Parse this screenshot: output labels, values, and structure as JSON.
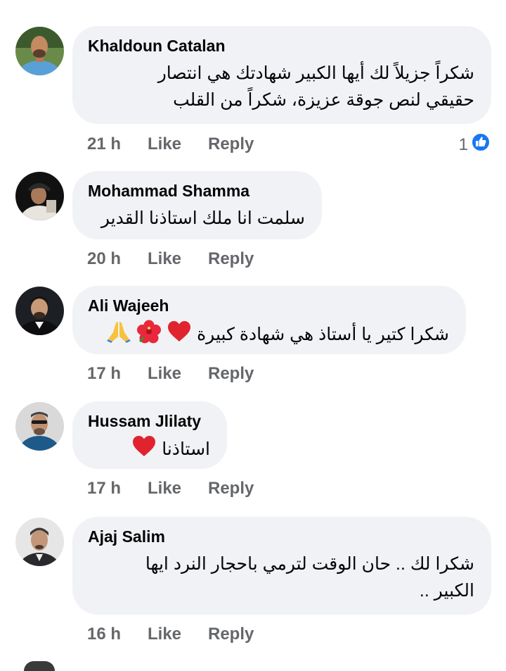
{
  "comments": [
    {
      "author": "Khaldoun Catalan",
      "lines": [
        "شكراً جزيلاً لك أيها الكبير شهادتك هي انتصار",
        "حقيقي لنص جوقة عزيزة، شكراً من القلب"
      ],
      "time": "21 h",
      "like_label": "Like",
      "reply_label": "Reply",
      "reactions": {
        "count": "1",
        "icon": "thumbs-up-icon",
        "color": "#1877f2"
      }
    },
    {
      "author": "Mohammad Shamma",
      "lines": [
        "سلمت انا ملك استاذنا القدير"
      ],
      "time": "20 h",
      "like_label": "Like",
      "reply_label": "Reply"
    },
    {
      "author": "Ali Wajeeh",
      "lines": [
        "شكرا كتير يا أستاذ هي شهادة كبيرة"
      ],
      "emojis": [
        "heart-emoji",
        "hibiscus-emoji",
        "folded-hands-emoji"
      ],
      "time": "17 h",
      "like_label": "Like",
      "reply_label": "Reply"
    },
    {
      "author": "Hussam Jlilaty",
      "lines": [
        "استاذنا"
      ],
      "emojis": [
        "heart-emoji"
      ],
      "time": "17 h",
      "like_label": "Like",
      "reply_label": "Reply"
    },
    {
      "author": "Ajaj Salim",
      "lines": [
        "شكرا لك .. حان الوقت لترمي باحجار النرد ايها",
        "الكبير .."
      ],
      "time": "16 h",
      "like_label": "Like",
      "reply_label": "Reply"
    }
  ],
  "colors": {
    "bubble": "#f0f2f5",
    "meta_text": "#65676b",
    "text": "#050505",
    "like_blue": "#1877f2",
    "heart_red": "#e0242f"
  }
}
